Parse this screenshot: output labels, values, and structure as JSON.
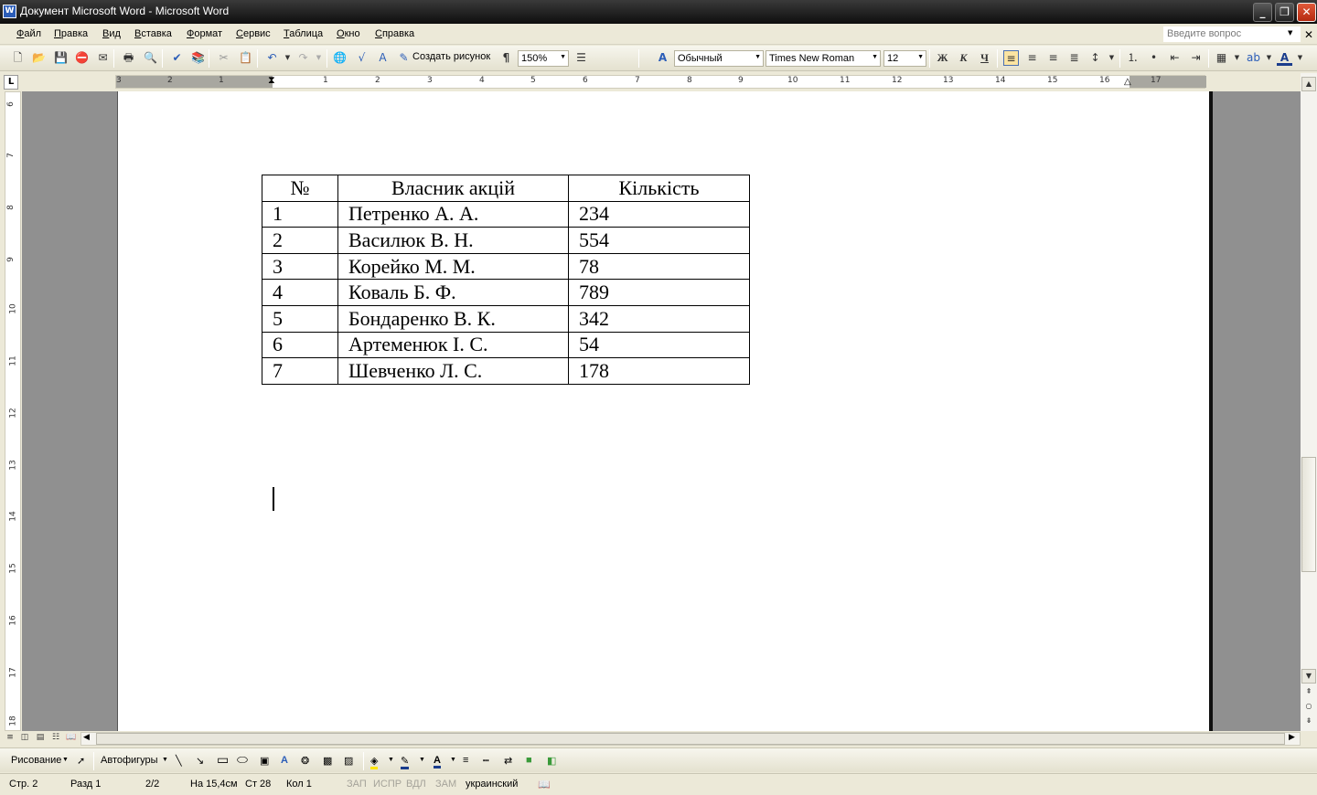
{
  "window": {
    "title": "Документ Microsoft Word - Microsoft Word",
    "icon": "word-app-icon"
  },
  "menu": {
    "items": [
      "Файл",
      "Правка",
      "Вид",
      "Вставка",
      "Формат",
      "Сервис",
      "Таблица",
      "Окно",
      "Справка"
    ],
    "help_placeholder": "Введите вопрос"
  },
  "toolbar": {
    "create_drawing": "Создать рисунок",
    "zoom": "150%",
    "style": "Обычный",
    "font": "Times New Roman",
    "font_size": "12",
    "bold": "Ж",
    "italic": "К",
    "underline": "Ч",
    "pilcrow": "¶"
  },
  "ruler": {
    "h_numbers": [
      "3",
      "2",
      "1",
      "1",
      "2",
      "3",
      "4",
      "5",
      "6",
      "7",
      "8",
      "9",
      "10",
      "11",
      "12",
      "13",
      "14",
      "15",
      "16",
      "17"
    ],
    "v_numbers": [
      "6",
      "7",
      "8",
      "9",
      "10",
      "11",
      "12",
      "13",
      "14",
      "15",
      "16",
      "17",
      "18"
    ],
    "corner": "L"
  },
  "table": {
    "headers": [
      "№",
      "Власник акцій",
      "Кількість"
    ],
    "rows": [
      [
        "1",
        "Петренко А. А.",
        "234"
      ],
      [
        "2",
        "Василюк В. Н.",
        "554"
      ],
      [
        "3",
        "Корейко М. М.",
        "78"
      ],
      [
        "4",
        "Коваль Б. Ф.",
        "789"
      ],
      [
        "5",
        "Бондаренко В. К.",
        "342"
      ],
      [
        "6",
        "Артеменюк І. С.",
        "54"
      ],
      [
        "7",
        "Шевченко Л. С.",
        "178"
      ]
    ]
  },
  "drawing": {
    "draw_label": "Рисование",
    "autoshapes_label": "Автофигуры"
  },
  "status": {
    "page": "Стр. 2",
    "section": "Разд 1",
    "pages": "2/2",
    "at": "На 15,4см",
    "line": "Ст 28",
    "col": "Кол 1",
    "rec": "ЗАП",
    "trk": "ИСПР",
    "ext": "ВДЛ",
    "ovr": "ЗАМ",
    "lang": "украинский"
  }
}
